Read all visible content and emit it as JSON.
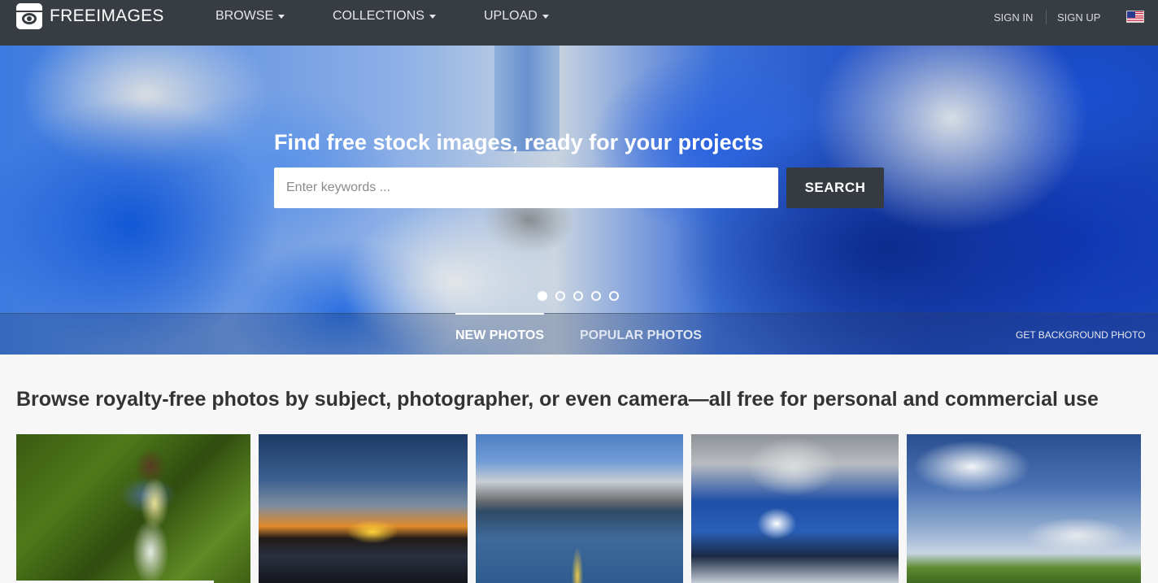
{
  "nav": {
    "logo_text": "FREEIMAGES",
    "items": [
      {
        "label": "BROWSE"
      },
      {
        "label": "COLLECTIONS"
      },
      {
        "label": "UPLOAD"
      }
    ],
    "sign_in": "SIGN IN",
    "sign_up": "SIGN UP",
    "language_flag_icon": "us-flag-icon"
  },
  "hero": {
    "title": "Find free stock images, ready for your projects",
    "search": {
      "placeholder": "Enter keywords ...",
      "value": "",
      "button_label": "SEARCH"
    },
    "slides": {
      "count": 5,
      "active_index": 0
    },
    "tabs": [
      {
        "label": "NEW PHOTOS",
        "active": true
      },
      {
        "label": "POPULAR PHOTOS",
        "active": false
      }
    ],
    "background_link": "GET BACKGROUND PHOTO"
  },
  "content": {
    "headline": "Browse royalty-free photos by subject, photographer, or even camera—all free for personal and commercial use"
  },
  "colors": {
    "navbar": "#373d43",
    "search_button": "#353b41",
    "page_background": "#f7f7f7"
  }
}
